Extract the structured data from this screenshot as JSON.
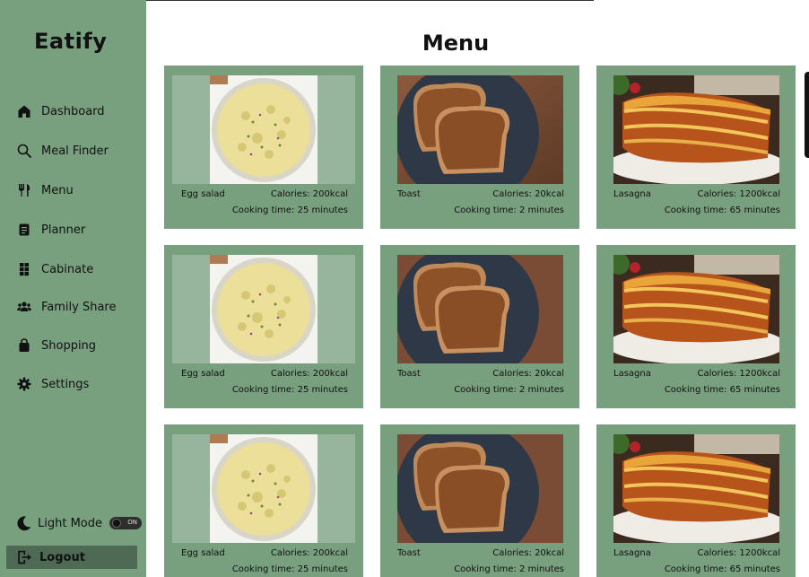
{
  "app": {
    "name": "Eatify"
  },
  "sidebar": {
    "items": [
      {
        "label": "Dashboard",
        "icon": "home-icon"
      },
      {
        "label": "Meal Finder",
        "icon": "search-icon"
      },
      {
        "label": "Menu",
        "icon": "utensils-icon"
      },
      {
        "label": "Planner",
        "icon": "planner-icon"
      },
      {
        "label": "Cabinate",
        "icon": "cabinet-icon"
      },
      {
        "label": "Family Share",
        "icon": "users-icon"
      },
      {
        "label": "Shopping",
        "icon": "shopping-bag-icon"
      },
      {
        "label": "Settings",
        "icon": "gear-icon"
      }
    ],
    "mode": {
      "label": "Light Mode",
      "icon": "moon-icon",
      "toggle_text": "ON"
    },
    "logout": {
      "label": "Logout",
      "icon": "logout-icon"
    }
  },
  "main": {
    "title": "Menu",
    "cards": [
      {
        "name": "Egg salad",
        "calories": "Calories: 200kcal",
        "time": "Cooking time: 25 minutes",
        "image": "egg-salad"
      },
      {
        "name": "Toast",
        "calories": "Calories: 20kcal",
        "time": "Cooking time: 2 minutes",
        "image": "toast"
      },
      {
        "name": "Lasagna",
        "calories": "Calories: 1200kcal",
        "time": "Cooking time: 65 minutes",
        "image": "lasagna"
      },
      {
        "name": "Egg salad",
        "calories": "Calories: 200kcal",
        "time": "Cooking time: 25 minutes",
        "image": "egg-salad"
      },
      {
        "name": "Toast",
        "calories": "Calories: 20kcal",
        "time": "Cooking time: 2 minutes",
        "image": "toast"
      },
      {
        "name": "Lasagna",
        "calories": "Calories: 1200kcal",
        "time": "Cooking time: 65 minutes",
        "image": "lasagna"
      },
      {
        "name": "Egg salad",
        "calories": "Calories: 200kcal",
        "time": "Cooking time: 25 minutes",
        "image": "egg-salad"
      },
      {
        "name": "Toast",
        "calories": "Calories: 20kcal",
        "time": "Cooking time: 2 minutes",
        "image": "toast"
      },
      {
        "name": "Lasagna",
        "calories": "Calories: 1200kcal",
        "time": "Cooking time: 65 minutes",
        "image": "lasagna"
      }
    ]
  },
  "colors": {
    "sidebar": "#78a07f",
    "card": "#78a07f",
    "logout_bg": "#4f6a54",
    "text": "#111111"
  }
}
